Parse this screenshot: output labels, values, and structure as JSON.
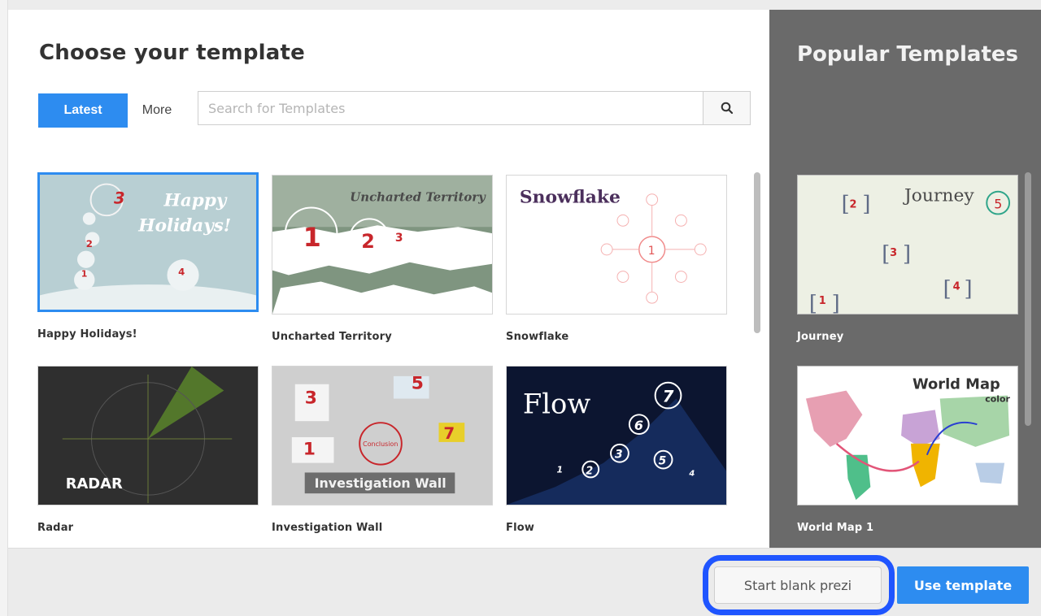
{
  "dialog": {
    "title": "Choose your template"
  },
  "tabs": {
    "latest": "Latest",
    "more": "More"
  },
  "search": {
    "placeholder": "Search for Templates",
    "icon": "search-icon"
  },
  "templates": [
    {
      "label": "Happy Holidays!",
      "thumb_text": "Happy Holidays!",
      "selected": true
    },
    {
      "label": "Uncharted Territory",
      "thumb_text": "Uncharted Territory"
    },
    {
      "label": "Snowflake",
      "thumb_text": "Snowflake"
    },
    {
      "label": "Radar",
      "thumb_text": "RADAR"
    },
    {
      "label": "Investigation Wall",
      "thumb_text": "Investigation Wall",
      "thumb_sub": "Conclusion"
    },
    {
      "label": "Flow",
      "thumb_text": "Flow"
    }
  ],
  "popular": {
    "title": "Popular Templates",
    "items": [
      {
        "label": "Journey",
        "thumb_text": "Journey"
      },
      {
        "label": "World Map 1",
        "thumb_text": "World Map",
        "thumb_sub": "color"
      }
    ]
  },
  "footer": {
    "blank_label": "Start blank prezi",
    "use_label": "Use template"
  },
  "colors": {
    "accent": "#2d8cf0",
    "sidebar": "#6a6a6a",
    "highlight": "#1f55ff"
  }
}
